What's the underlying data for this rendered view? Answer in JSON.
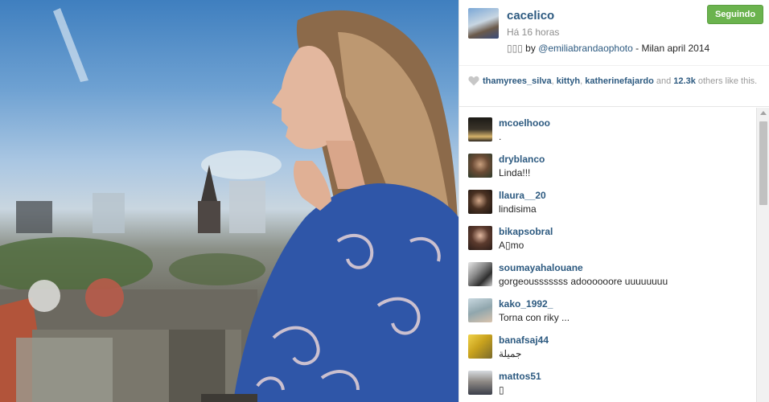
{
  "post": {
    "owner": "cacelico",
    "time": "Há 16 horas",
    "caption_glyphs": "▯▯▯",
    "caption_by": "by",
    "caption_mention": "@emiliabrandaophoto",
    "caption_rest": "- Milan april 2014",
    "follow_label": "Seguindo"
  },
  "likes": {
    "users": [
      "thamyrees_silva",
      "kittyh",
      "katherinefajardo"
    ],
    "count": "12.3k",
    "sep1": ", ",
    "sep2": ", ",
    "and": " and ",
    "suffix": " others like this."
  },
  "comments": [
    {
      "user": "mcoelhooo",
      "text": "."
    },
    {
      "user": "dryblanco",
      "text": "Linda!!!"
    },
    {
      "user": "llaura__20",
      "text": "lindisima"
    },
    {
      "user": "bikapsobral",
      "text": "A▯mo"
    },
    {
      "user": "soumayahalouane",
      "text": "gorgeousssssss adoooooore uuuuuuuu"
    },
    {
      "user": "kako_1992_",
      "text": "Torna con riky ..."
    },
    {
      "user": "banafsaj44",
      "text": "جميلة"
    },
    {
      "user": "mattos51",
      "text": "▯"
    }
  ],
  "icons": {
    "heart": "heart-icon",
    "scroll": "scroll-up-icon"
  },
  "colors": {
    "username": "#2d5a80",
    "follow_button": "#6bb34e",
    "muted": "#8e8e8e"
  }
}
